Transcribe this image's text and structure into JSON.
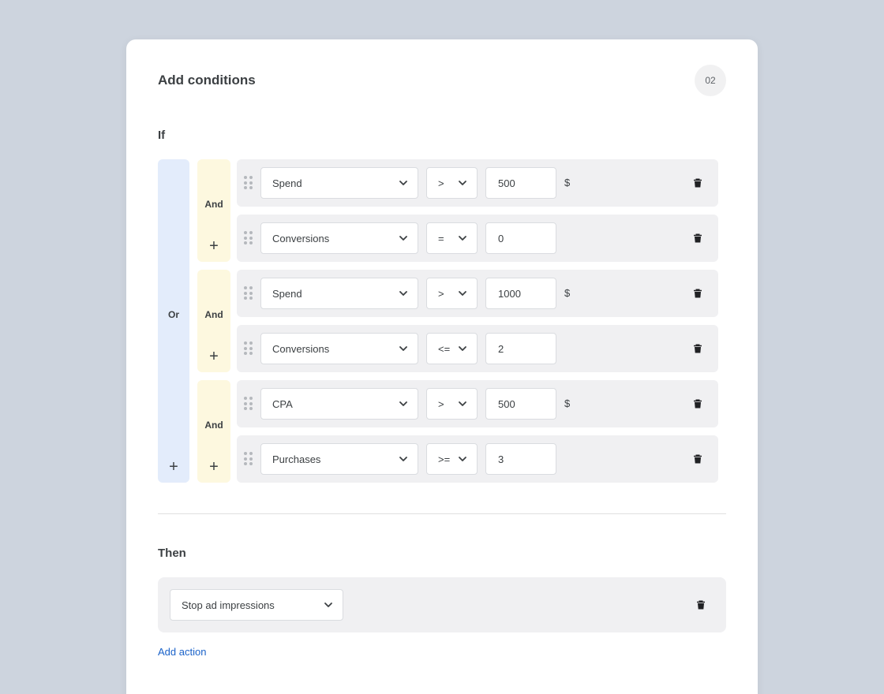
{
  "card": {
    "title": "Add conditions",
    "step": "02"
  },
  "if_section": {
    "label": "If",
    "or_label": "Or",
    "or_add": "+",
    "groups": [
      {
        "and_label": "And",
        "add": "+",
        "rows": [
          {
            "metric": "Spend",
            "operator": ">",
            "value": "500",
            "unit": "$"
          },
          {
            "metric": "Conversions",
            "operator": "=",
            "value": "0",
            "unit": ""
          }
        ]
      },
      {
        "and_label": "And",
        "add": "+",
        "rows": [
          {
            "metric": "Spend",
            "operator": ">",
            "value": "1000",
            "unit": "$"
          },
          {
            "metric": "Conversions",
            "operator": "<=",
            "value": "2",
            "unit": ""
          }
        ]
      },
      {
        "and_label": "And",
        "add": "+",
        "rows": [
          {
            "metric": "CPA",
            "operator": ">",
            "value": "500",
            "unit": "$"
          },
          {
            "metric": "Purchases",
            "operator": ">=",
            "value": "3",
            "unit": ""
          }
        ]
      }
    ]
  },
  "then_section": {
    "label": "Then",
    "action": "Stop ad impressions",
    "add_action": "Add action"
  },
  "icons": {
    "drag": "drag-handle-icon",
    "chevron": "chevron-down-icon",
    "trash": "trash-icon"
  },
  "colors": {
    "background": "#cdd4de",
    "or_column": "#e3ecfb",
    "and_column": "#fdf8df",
    "row": "#f0f0f2",
    "link": "#1a62c9"
  }
}
